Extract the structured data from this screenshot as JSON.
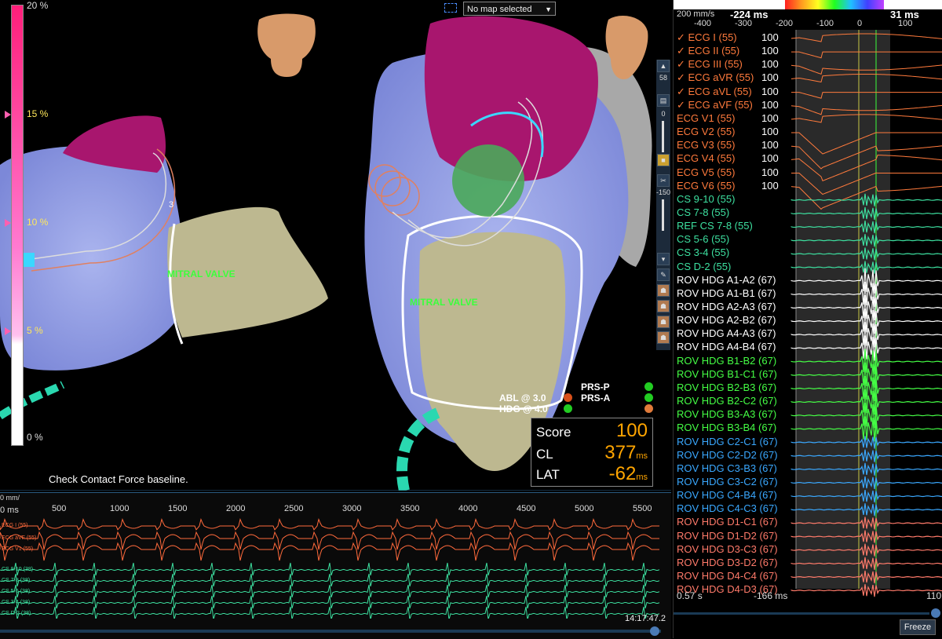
{
  "scale": {
    "labels": [
      "20 %",
      "15 %",
      "10 %",
      "5 %",
      "0 %"
    ]
  },
  "map": {
    "selected": "No map selected"
  },
  "anatomy": {
    "left_label": "MITRAL VALVE",
    "right_label": "MITRAL VALVE",
    "electrode_number": "3"
  },
  "status": {
    "message": "Check Contact Force baseline."
  },
  "tools": {
    "zoom_value": "58",
    "slider_top": "0",
    "slider_bottom": "-150"
  },
  "catheters": {
    "abl": "ABL @ 3.0",
    "hdg": "HDG @ 4.0",
    "prs_p": "PRS-P",
    "prs_a": "PRS-A"
  },
  "score_box": {
    "score_label": "Score",
    "score_value": "100",
    "cl_label": "CL",
    "cl_value": "377",
    "cl_unit": "ms",
    "lat_label": "LAT",
    "lat_value": "-62",
    "lat_unit": "ms"
  },
  "strip": {
    "speed": "0 mm/",
    "zero": "0 ms",
    "ticks": [
      "500",
      "1000",
      "1500",
      "2000",
      "2500",
      "3000",
      "3500",
      "4000",
      "4500",
      "5000",
      "5500"
    ],
    "labels": [
      "ECG I (55)",
      "ECG aVF (55)",
      "ECG V1 (55)",
      "CS 9-10 (38)",
      "CS 7-8 (38)",
      "CS 5-6 (38)",
      "CS 3-4 (38)",
      "CS D-2 (38)"
    ],
    "time": "14:17:47.2"
  },
  "ekg": {
    "speed": "200 mm/s",
    "left_time": "-224 ms",
    "right_time": "31 ms",
    "ruler": [
      "-400",
      "-300",
      "-200",
      "-100",
      "0",
      "100"
    ],
    "bottom_left": "0.57 s",
    "bottom_mid": "-166 ms",
    "bottom_right": "110",
    "freeze": "Freeze",
    "channels": [
      {
        "label": "✓ ECG I (55)",
        "value": "100",
        "color": "#ff7a3c"
      },
      {
        "label": "✓ ECG II (55)",
        "value": "100",
        "color": "#ff7a3c"
      },
      {
        "label": "✓ ECG III (55)",
        "value": "100",
        "color": "#ff7a3c"
      },
      {
        "label": "✓ ECG aVR (55)",
        "value": "100",
        "color": "#ff7a3c"
      },
      {
        "label": "✓ ECG aVL (55)",
        "value": "100",
        "color": "#ff7a3c"
      },
      {
        "label": "✓ ECG aVF (55)",
        "value": "100",
        "color": "#ff7a3c"
      },
      {
        "label": "ECG V1 (55)",
        "value": "100",
        "color": "#ff7a3c"
      },
      {
        "label": "ECG V2 (55)",
        "value": "100",
        "color": "#ff7a3c"
      },
      {
        "label": "ECG V3 (55)",
        "value": "100",
        "color": "#ff7a3c"
      },
      {
        "label": "ECG V4 (55)",
        "value": "100",
        "color": "#ff7a3c"
      },
      {
        "label": "ECG V5 (55)",
        "value": "100",
        "color": "#ff7a3c"
      },
      {
        "label": "ECG V6 (55)",
        "value": "100",
        "color": "#ff7a3c"
      },
      {
        "label": "CS 9-10 (55)",
        "value": "",
        "color": "#3de0a0"
      },
      {
        "label": "CS 7-8 (55)",
        "value": "",
        "color": "#3de0a0"
      },
      {
        "label": "REF CS 7-8 (55)",
        "value": "",
        "color": "#3de0a0"
      },
      {
        "label": "CS 5-6 (55)",
        "value": "",
        "color": "#3de0a0"
      },
      {
        "label": "CS 3-4 (55)",
        "value": "",
        "color": "#3de0a0"
      },
      {
        "label": "CS D-2 (55)",
        "value": "",
        "color": "#3de0a0"
      },
      {
        "label": "ROV HDG A1-A2 (67)",
        "value": "",
        "color": "#ffffff"
      },
      {
        "label": "ROV HDG A1-B1 (67)",
        "value": "",
        "color": "#ffffff"
      },
      {
        "label": "ROV HDG A2-A3 (67)",
        "value": "",
        "color": "#ffffff"
      },
      {
        "label": "ROV HDG A2-B2 (67)",
        "value": "",
        "color": "#ffffff"
      },
      {
        "label": "ROV HDG A4-A3 (67)",
        "value": "",
        "color": "#ffffff"
      },
      {
        "label": "ROV HDG A4-B4 (67)",
        "value": "",
        "color": "#ffffff"
      },
      {
        "label": "ROV HDG B1-B2 (67)",
        "value": "",
        "color": "#45ff45"
      },
      {
        "label": "ROV HDG B1-C1 (67)",
        "value": "",
        "color": "#45ff45"
      },
      {
        "label": "ROV HDG B2-B3 (67)",
        "value": "",
        "color": "#45ff45"
      },
      {
        "label": "ROV HDG B2-C2 (67)",
        "value": "",
        "color": "#45ff45"
      },
      {
        "label": "ROV HDG B3-A3 (67)",
        "value": "",
        "color": "#45ff45"
      },
      {
        "label": "ROV HDG B3-B4 (67)",
        "value": "",
        "color": "#45ff45"
      },
      {
        "label": "ROV HDG C2-C1 (67)",
        "value": "",
        "color": "#3aa8ff"
      },
      {
        "label": "ROV HDG C2-D2 (67)",
        "value": "",
        "color": "#3aa8ff"
      },
      {
        "label": "ROV HDG C3-B3 (67)",
        "value": "",
        "color": "#3aa8ff"
      },
      {
        "label": "ROV HDG C3-C2 (67)",
        "value": "",
        "color": "#3aa8ff"
      },
      {
        "label": "ROV HDG C4-B4 (67)",
        "value": "",
        "color": "#3aa8ff"
      },
      {
        "label": "ROV HDG C4-C3 (67)",
        "value": "",
        "color": "#3aa8ff"
      },
      {
        "label": "ROV HDG D1-C1 (67)",
        "value": "",
        "color": "#ff7a6a"
      },
      {
        "label": "ROV HDG D1-D2 (67)",
        "value": "",
        "color": "#ff7a6a"
      },
      {
        "label": "ROV HDG D3-C3 (67)",
        "value": "",
        "color": "#ff7a6a"
      },
      {
        "label": "ROV HDG D3-D2 (67)",
        "value": "",
        "color": "#ff7a6a"
      },
      {
        "label": "ROV HDG D4-C4 (67)",
        "value": "",
        "color": "#ff7a6a"
      },
      {
        "label": "ROV HDG D4-D3 (67)",
        "value": "",
        "color": "#ff7a6a"
      }
    ]
  }
}
